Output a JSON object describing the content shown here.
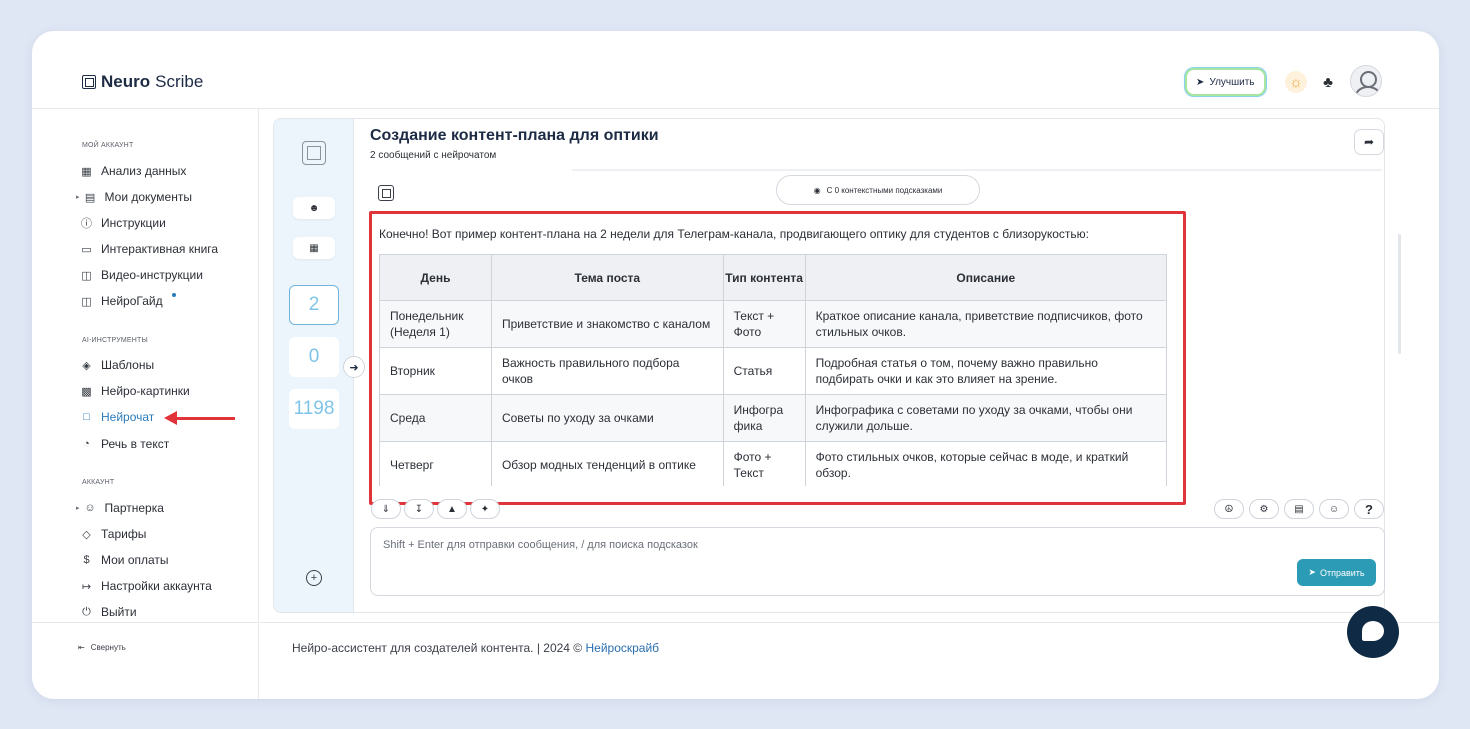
{
  "brand": {
    "bold": "Neuro",
    "light": "Scribe"
  },
  "topbar": {
    "upgrade_label": "Улучшить"
  },
  "sidebar": {
    "section_account": "МОЙ АККАУНТ",
    "section_ai": "AI-ИНСТРУМЕНТЫ",
    "section_acc2": "АККАУНТ",
    "items_account": [
      {
        "label": "Анализ данных",
        "icon": "grid-icon"
      },
      {
        "label": "Мои документы",
        "icon": "document-icon"
      },
      {
        "label": "Инструкции",
        "icon": "question-icon"
      },
      {
        "label": "Интерактивная книга",
        "icon": "book-icon"
      },
      {
        "label": "Видео-инструкции",
        "icon": "video-icon"
      },
      {
        "label": "НейроГайд",
        "icon": "guide-icon"
      }
    ],
    "items_ai": [
      {
        "label": "Шаблоны",
        "icon": "layers-icon"
      },
      {
        "label": "Нейро-картинки",
        "icon": "image-icon"
      },
      {
        "label": "Нейрочат",
        "icon": "chat-icon"
      },
      {
        "label": "Речь в текст",
        "icon": "headphones-icon"
      }
    ],
    "items_acc2": [
      {
        "label": "Партнерка",
        "icon": "users-icon"
      },
      {
        "label": "Тарифы",
        "icon": "tag-icon"
      },
      {
        "label": "Мои оплаты",
        "icon": "dollar-icon"
      },
      {
        "label": "Настройки аккаунта",
        "icon": "login-icon"
      },
      {
        "label": "Выйти",
        "icon": "power-icon"
      }
    ],
    "collapse_label": "Свернуть"
  },
  "rail": {
    "counts": [
      "2",
      "0",
      "1198"
    ]
  },
  "chat": {
    "title": "Создание контент-плана для оптики",
    "subtitle": "2 сообщений с нейрочатом",
    "hints_label": "С 0 контекстными подсказками",
    "intro": "Конечно! Вот пример контент-плана на 2 недели для Телеграм-канала, продвигающего оптику для студентов с близорукостью:",
    "table": {
      "headers": [
        "День",
        "Тема поста",
        "Тип контента",
        "Описание"
      ],
      "rows": [
        [
          "Понедельник (Неделя 1)",
          "Приветствие и знакомство с каналом",
          "Текст + Фото",
          "Краткое описание канала, приветствие подписчиков, фото стильных очков."
        ],
        [
          "Вторник",
          "Важность правильного подбора очков",
          "Статья",
          "Подробная статья о том, почему важно правильно подбирать очки и как это влияет на зрение."
        ],
        [
          "Среда",
          "Советы по уходу за очками",
          "Инфогра фика",
          "Инфографика с советами по уходу за очками, чтобы они служили дольше."
        ],
        [
          "Четверг",
          "Обзор модных тенденций в оптике",
          "Фото + Текст",
          "Фото стильных очков, которые сейчас в моде, и краткий обзор."
        ]
      ]
    },
    "input_placeholder": "Shift + Enter для отправки сообщения, / для поиска подсказок",
    "send_label": "Отправить"
  },
  "footer": {
    "text": "Нейро-ассистент для создателей контента.  | 2024 © ",
    "link": "Нейроскрайб"
  },
  "colors": {
    "accent": "#2b9bb6",
    "highlight": "#e0343a",
    "link": "#2b7bb9"
  }
}
